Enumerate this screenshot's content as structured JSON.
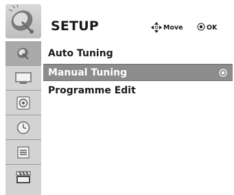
{
  "header": {
    "title": "SETUP",
    "hint_move": "Move",
    "hint_ok": "OK"
  },
  "sidebar": {
    "items": [
      {
        "name": "setup-category-icon",
        "active": true
      },
      {
        "name": "picture-category-icon",
        "active": false
      },
      {
        "name": "audio-category-icon",
        "active": false
      },
      {
        "name": "time-category-icon",
        "active": false
      },
      {
        "name": "option-category-icon",
        "active": false
      },
      {
        "name": "media-category-icon",
        "active": false
      }
    ]
  },
  "menu": {
    "items": [
      {
        "label": "Auto Tuning",
        "selected": false
      },
      {
        "label": "Manual Tuning",
        "selected": true
      },
      {
        "label": "Programme Edit",
        "selected": false
      }
    ]
  },
  "colors": {
    "selected_bg": "#8c8c8c",
    "sidebar_bg": "#d3d3d3",
    "sidebar_active": "#a9a9a9"
  }
}
